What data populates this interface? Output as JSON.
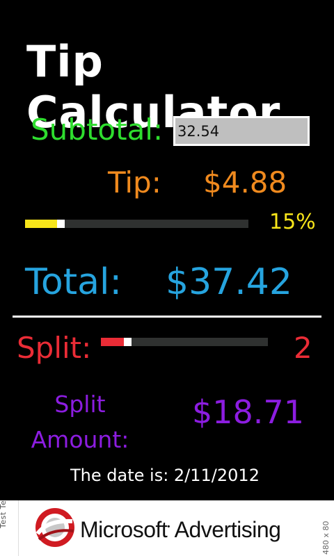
{
  "app": {
    "title": "Tip Calculator"
  },
  "subtotal": {
    "label": "Subtotal:",
    "value": "32.54"
  },
  "tip": {
    "label": "Tip:",
    "amount": "$4.88",
    "percent_text": "15%",
    "slider_fraction": 0.15,
    "color": "#f7e51a"
  },
  "total": {
    "label": "Total:",
    "amount": "$37.42"
  },
  "split": {
    "label": "Split:",
    "count": "2",
    "slider_fraction": 0.14,
    "color": "#ea2c36"
  },
  "split_amount": {
    "label_line1": "Split",
    "label_line2": "Amount:",
    "amount": "$18.71"
  },
  "date": {
    "text": "The date is: 2/11/2012"
  },
  "ad": {
    "brand": "Microsoft",
    "brand_rest": "Advertising",
    "left_vertical": "Test Test Test",
    "right_vertical": "480 x 80"
  },
  "colors": {
    "subtotal": "#2edd2e",
    "tip": "#f08a1e",
    "total": "#26a4df",
    "split": "#ea2c36",
    "split_amount": "#8c1de0"
  }
}
